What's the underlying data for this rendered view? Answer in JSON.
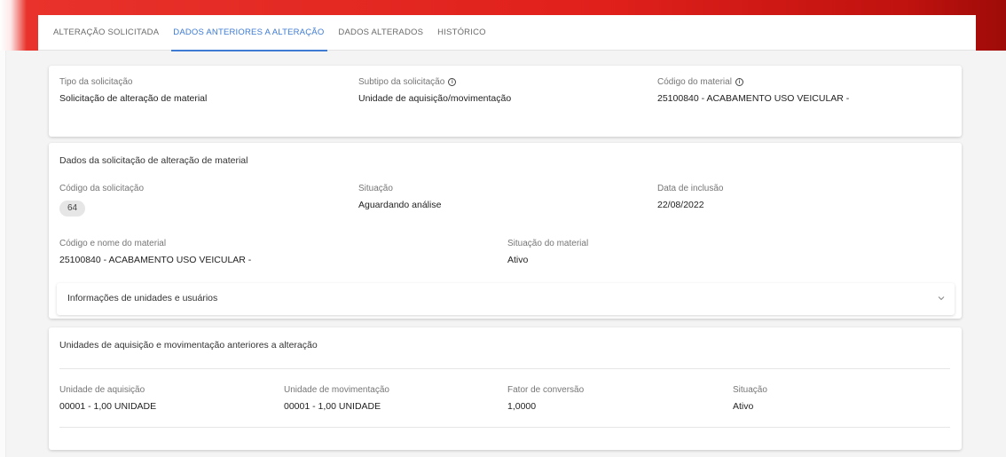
{
  "tabs": [
    {
      "label": "ALTERAÇÃO SOLICITADA",
      "active": false
    },
    {
      "label": "DADOS ANTERIORES A ALTERAÇÃO",
      "active": true
    },
    {
      "label": "DADOS ALTERADOS",
      "active": false
    },
    {
      "label": "HISTÓRICO",
      "active": false
    }
  ],
  "summary": {
    "tipo_label": "Tipo da solicitação",
    "tipo_value": "Solicitação de alteração de material",
    "subtipo_label": "Subtipo da solicitação",
    "subtipo_value": "Unidade de aquisição/movimentação",
    "codigo_label": "Código do material",
    "codigo_value": "25100840 - ACABAMENTO USO VEICULAR -"
  },
  "dados": {
    "heading": "Dados da solicitação de alteração de material",
    "codigo_solicitacao_label": "Código da solicitação",
    "codigo_solicitacao_value": "64",
    "situacao_label": "Situação",
    "situacao_value": "Aguardando análise",
    "data_inclusao_label": "Data de inclusão",
    "data_inclusao_value": "22/08/2022",
    "codigo_nome_label": "Código e nome do material",
    "codigo_nome_value": "25100840 - ACABAMENTO USO VEICULAR -",
    "situacao_material_label": "Situação do material",
    "situacao_material_value": "Ativo",
    "expander_label": "Informações de unidades e usuários"
  },
  "unidades": {
    "heading": "Unidades de aquisição e movimentação anteriores a alteração",
    "aquisicao_label": "Unidade de aquisição",
    "aquisicao_value": "00001 - 1,00 UNIDADE",
    "movimentacao_label": "Unidade de movimentação",
    "movimentacao_value": "00001 - 1,00 UNIDADE",
    "fator_label": "Fator de conversão",
    "fator_value": "1,0000",
    "situacao_label": "Situação",
    "situacao_value": "Ativo"
  },
  "colors": {
    "accent": "#3d7bd4",
    "header_red": "#e0201b"
  },
  "icons": [
    "info-icon",
    "chevron-down-icon"
  ]
}
